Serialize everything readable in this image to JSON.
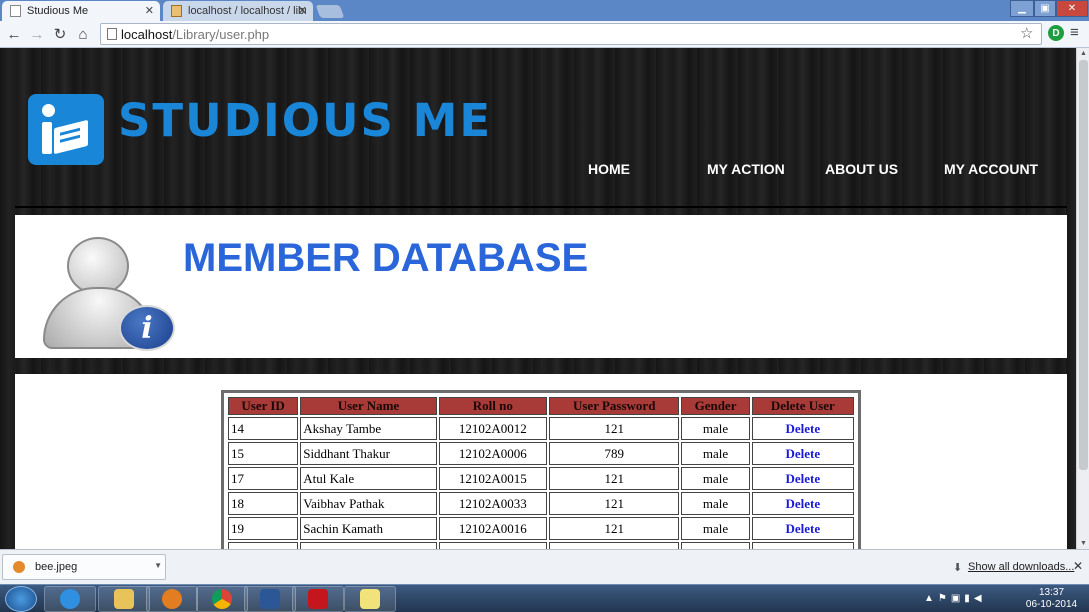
{
  "browser": {
    "tabs": [
      {
        "label": "Studious Me",
        "active": true
      },
      {
        "label": "localhost / localhost / libr",
        "active": false
      }
    ],
    "url_host": "localhost",
    "url_path": "/Library/user.php"
  },
  "header": {
    "brand": "STUDIOUS ME",
    "nav": {
      "home": "HOME",
      "my_action": "MY ACTION",
      "about_us": "ABOUT US",
      "my_account": "MY ACCOUNT"
    }
  },
  "banner": {
    "title": "MEMBER DATABASE"
  },
  "table": {
    "headers": {
      "user_id": "User ID",
      "user_name": "User Name",
      "roll_no": "Roll no",
      "password": "User Password",
      "gender": "Gender",
      "delete": "Delete User"
    },
    "rows": [
      {
        "id": "14",
        "name": "Akshay Tambe",
        "roll": "12102A0012",
        "password": "121",
        "gender": "male",
        "action": "Delete"
      },
      {
        "id": "15",
        "name": "Siddhant Thakur",
        "roll": "12102A0006",
        "password": "789",
        "gender": "male",
        "action": "Delete"
      },
      {
        "id": "17",
        "name": "Atul Kale",
        "roll": "12102A0015",
        "password": "121",
        "gender": "male",
        "action": "Delete"
      },
      {
        "id": "18",
        "name": "Vaibhav Pathak",
        "roll": "12102A0033",
        "password": "121",
        "gender": "male",
        "action": "Delete"
      },
      {
        "id": "19",
        "name": "Sachin Kamath",
        "roll": "12102A0016",
        "password": "121",
        "gender": "male",
        "action": "Delete"
      }
    ]
  },
  "downloads": {
    "file": "bee.jpeg",
    "show_all": "Show all downloads..."
  },
  "taskbar": {
    "time": "13:37",
    "date": "06-10-2014"
  }
}
